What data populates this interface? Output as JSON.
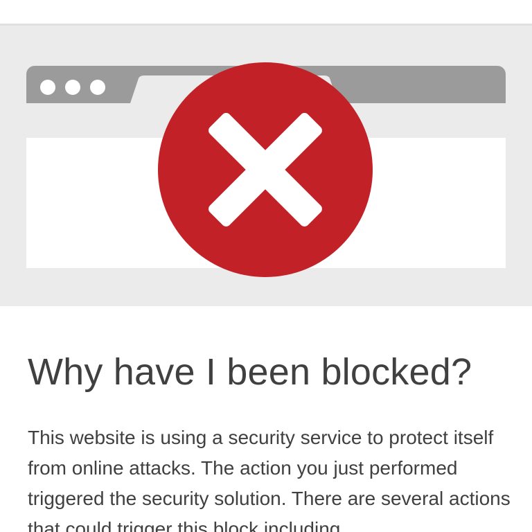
{
  "page": {
    "heading": "Why have I been blocked?",
    "body": "This website is using a security service to protect itself from online attacks. The action you just performed triggered the security solution. There are several actions that could trigger this block including"
  },
  "illustration": {
    "icon": "error-x-icon",
    "colors": {
      "error_red": "#c12127",
      "browser_chrome": "#9b9b9b",
      "hero_background": "#ebebeb"
    }
  }
}
